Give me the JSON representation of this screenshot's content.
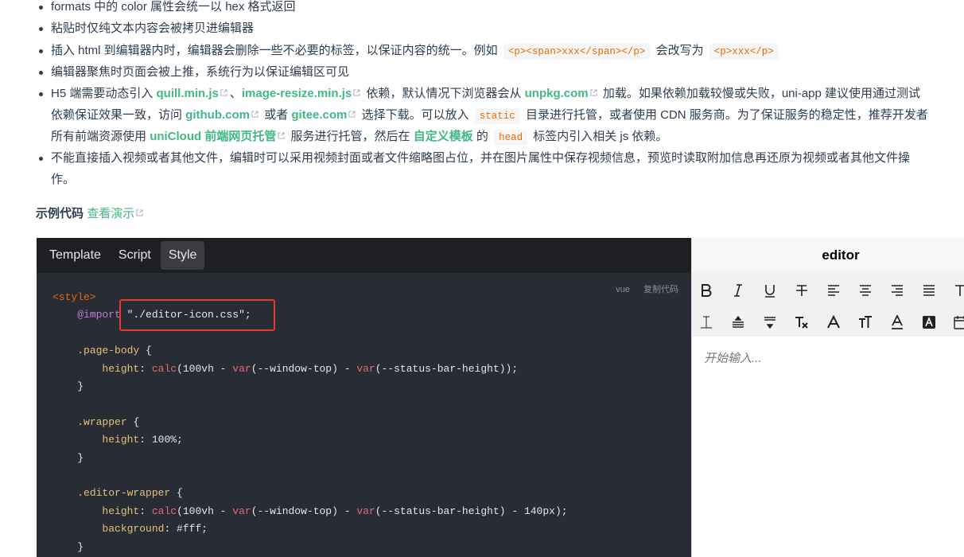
{
  "list": {
    "item1": {
      "text": "formats 中的 color 属性会统一以 hex 格式返回"
    },
    "item2": {
      "text": "粘贴时仅纯文本内容会被拷贝进编辑器"
    },
    "item3": {
      "a": "插入 html 到编辑器内时，编辑器会删除一些不必要的标签，以保证内容的统一。例如",
      "code1": "<p><span>xxx</span></p>",
      "b": "会改写为",
      "code2": "<p>xxx</p>"
    },
    "item4": {
      "text": "编辑器聚焦时页面会被上推，系统行为以保证编辑区可见"
    },
    "item5": {
      "l1a": "H5 端需要动态引入",
      "link1": "quill.min.js",
      "l1b": "、",
      "link2": "image-resize.min.js",
      "l1c": "依赖，默认情况下浏览器会从",
      "link3": "unpkg.com",
      "l1d": "加载。如果依赖加载较慢或失败，uni-app 建议使用通过测试",
      "l2a": "依赖保证效果一致，访问",
      "link4": "github.com",
      "l2b": "或者",
      "link5": "gitee.com",
      "l2c": "选择下载。可以放入",
      "code1": "static",
      "l2d": "目录进行托管，或者使用 CDN 服务商。为了保证服务的稳定性，推荐开发者",
      "l3a": "所有前端资源使用",
      "link6": "uniCloud 前端网页托管",
      "l3b": "服务进行托管，然后在",
      "link7": "自定义模板",
      "l3c": "的",
      "code2": "head",
      "l3d": "标签内引入相关 js 依赖。"
    },
    "item6": {
      "l1": "不能直接插入视频或者其他文件，编辑时可以采用视频封面或者文件缩略图占位，并在图片属性中保存视频信息，预览时读取附加信息再还原为视频或者其他文件操",
      "l2": "作。"
    }
  },
  "heading": {
    "title": "示例代码",
    "link": "查看演示"
  },
  "code_panel": {
    "tabs": [
      "Template",
      "Script",
      "Style"
    ],
    "active_tab": "Style",
    "lang": "vue",
    "copy_label": "复制代码",
    "lines": {
      "l1": "<style>",
      "l2_kw": "@import",
      "l2_str": "\"./editor-icon.css\"",
      "l2_end": ";",
      "l4_sel": ".page-body",
      "l4_end": " {",
      "l5_prop": "height",
      "l5_fn1": "calc",
      "l5_a": "(100vh - ",
      "l5_fn2": "var",
      "l5_b": "(--window-top) - ",
      "l5_fn3": "var",
      "l5_c": "(--status-bar-height));",
      "l6": "}",
      "l8_sel": ".wrapper",
      "l8_end": " {",
      "l9_prop": "height",
      "l9_val": "100%;",
      "l10": "}",
      "l12_sel": ".editor-wrapper",
      "l12_end": " {",
      "l13_prop": "height",
      "l13_fn1": "calc",
      "l13_a": "(100vh - ",
      "l13_fn2": "var",
      "l13_b": "(--window-top) - ",
      "l13_fn3": "var",
      "l13_c": "(--status-bar-height) - 140px);",
      "l14_prop": "background",
      "l14_val": "#fff;",
      "l15": "}"
    }
  },
  "preview": {
    "title": "editor",
    "placeholder": "开始输入...",
    "toolbar_row1": [
      "bold-icon",
      "italic-icon",
      "underline-icon",
      "strikethrough-icon",
      "align-left-icon",
      "align-center-icon",
      "align-right-icon",
      "align-justify-icon",
      "text-size-icon"
    ],
    "toolbar_row2": [
      "line-height-icon",
      "letter-spacing-icon",
      "paragraph-spacing-icon",
      "clear-format-icon",
      "font-icon",
      "font-size-icon",
      "text-color-icon",
      "background-color-icon",
      "date-icon"
    ]
  }
}
